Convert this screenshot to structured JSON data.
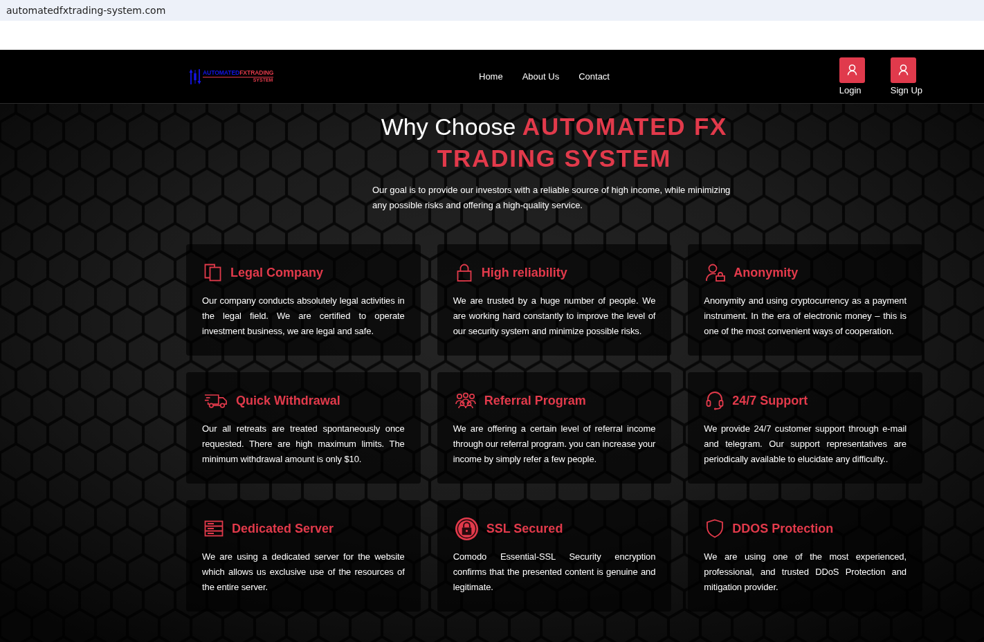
{
  "browser": {
    "address": "automatedfxtrading-system.com"
  },
  "header": {
    "logo": {
      "word_1": "AUTOMATED",
      "word_2": "FXTRADING",
      "tagline": "SYSTEM"
    },
    "nav": [
      {
        "label": "Home"
      },
      {
        "label": "About Us"
      },
      {
        "label": "Contact"
      }
    ],
    "account_links": [
      {
        "label": "Login"
      },
      {
        "label": "Sign Up"
      }
    ]
  },
  "hero": {
    "title": "Why Choose **AUTOMATED FX TRADING SYSTEM**",
    "intro": "Our goal is to provide our investors with a reliable source of high income, while minimizing any possible risks and offering a high-quality service."
  },
  "features": [
    {
      "kind": "documents",
      "title": "Legal Company",
      "text": "Our company conducts absolutely legal activities in the legal field. We are certified to operate investment business, we are legal and safe."
    },
    {
      "kind": "padlock",
      "title": "High reliability",
      "text": "We are trusted by a huge number of people. We are working hard constantly to improve the level of our security system and minimize possible risks."
    },
    {
      "kind": "user_lock",
      "title": "Anonymity",
      "text": "Anonymity and using cryptocurrency as a payment instrument. In the era of electronic money – this is one of the most convenient ways of cooperation."
    },
    {
      "kind": "truck",
      "title": "Quick Withdrawal",
      "text": "Our all retreats are treated spontaneously once requested. There are high maximum limits. The minimum withdrawal amount is only $10."
    },
    {
      "kind": "people",
      "title": "Referral Program",
      "text": "We are offering a certain level of referral income through our referral program. you can increase your income by simply refer a few people."
    },
    {
      "kind": "headset",
      "title": "24/7 Support",
      "text": "We provide 24/7 customer support through e-mail and telegram. Our support representatives are periodically available to elucidate any difficulty.."
    },
    {
      "kind": "server",
      "title": "Dedicated Server",
      "text": "We are using a dedicated server for the website which allows us exclusive use of the resources of the entire server."
    },
    {
      "kind": "ssl",
      "title": "SSL Secured",
      "text": "Comodo Essential-SSL Security encryption confirms that the presented content is genuine and legitimate."
    },
    {
      "kind": "shield",
      "title": "DDOS Protection",
      "text": "We are using one of the most experienced, professional, and trusted DDoS Protection and mitigation provider."
    }
  ]
}
